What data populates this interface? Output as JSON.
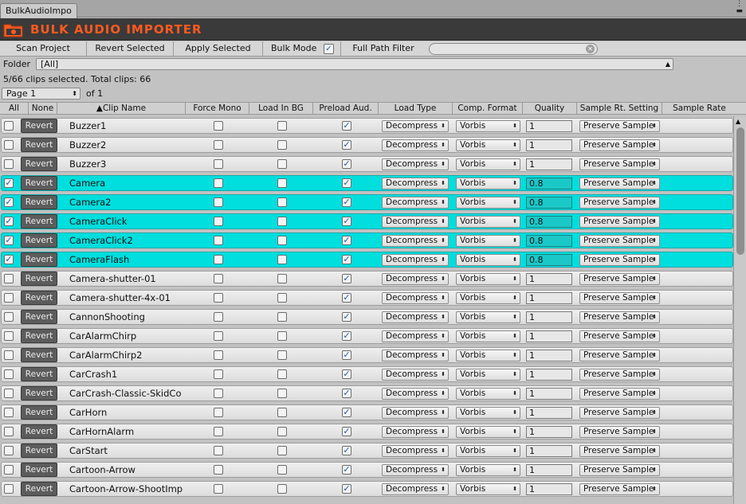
{
  "window": {
    "tab_title": "BulkAudioImpo",
    "menu_icon": "three-dots-icon",
    "close_icon": "close-icon"
  },
  "banner": {
    "title": "BULK AUDIO IMPORTER",
    "title_color": "#ff5a1f"
  },
  "toolbar": {
    "scan_label": "Scan Project",
    "revert_label": "Revert Selected",
    "apply_label": "Apply Selected",
    "bulk_mode_label": "Bulk Mode",
    "bulk_mode_checked": true,
    "filter_label": "Full Path Filter",
    "filter_value": ""
  },
  "folder": {
    "label": "Folder",
    "selected": "[All]"
  },
  "summary": "5/66 clips selected. Total clips: 66",
  "pager": {
    "selected": "Page 1",
    "of_label": "of 1"
  },
  "columns": {
    "all": "All",
    "none": "None",
    "clip_name": "▲Clip Name",
    "force_mono": "Force Mono",
    "load_in_bg": "Load In BG",
    "preload": "Preload Aud.",
    "load_type": "Load Type",
    "comp_format": "Comp. Format",
    "quality": "Quality",
    "sample_setting": "Sample Rt. Setting",
    "sample_rate": "Sample Rate"
  },
  "colors": {
    "selected_row": "#00dede",
    "revert_button": "#5c5c5c"
  },
  "rows": [
    {
      "selected": false,
      "revert": "Revert",
      "name": "Buzzer1",
      "force_mono": false,
      "load_bg": false,
      "preload": true,
      "load_type": "Decompress",
      "format": "Vorbis",
      "quality": "1",
      "sample_setting": "Preserve Sample"
    },
    {
      "selected": false,
      "revert": "Revert",
      "name": "Buzzer2",
      "force_mono": false,
      "load_bg": false,
      "preload": true,
      "load_type": "Decompress",
      "format": "Vorbis",
      "quality": "1",
      "sample_setting": "Preserve Sample"
    },
    {
      "selected": false,
      "revert": "Revert",
      "name": "Buzzer3",
      "force_mono": false,
      "load_bg": false,
      "preload": true,
      "load_type": "Decompress",
      "format": "Vorbis",
      "quality": "1",
      "sample_setting": "Preserve Sample"
    },
    {
      "selected": true,
      "revert": "Revert",
      "name": "Camera",
      "force_mono": false,
      "load_bg": false,
      "preload": true,
      "load_type": "Decompress",
      "format": "Vorbis",
      "quality": "0.8",
      "sample_setting": "Preserve Sample"
    },
    {
      "selected": true,
      "revert": "Revert",
      "name": "Camera2",
      "force_mono": false,
      "load_bg": false,
      "preload": true,
      "load_type": "Decompress",
      "format": "Vorbis",
      "quality": "0.8",
      "sample_setting": "Preserve Sample"
    },
    {
      "selected": true,
      "revert": "Revert",
      "name": "CameraClick",
      "force_mono": false,
      "load_bg": false,
      "preload": true,
      "load_type": "Decompress",
      "format": "Vorbis",
      "quality": "0.8",
      "sample_setting": "Preserve Sample"
    },
    {
      "selected": true,
      "revert": "Revert",
      "name": "CameraClick2",
      "force_mono": false,
      "load_bg": false,
      "preload": true,
      "load_type": "Decompress",
      "format": "Vorbis",
      "quality": "0.8",
      "sample_setting": "Preserve Sample"
    },
    {
      "selected": true,
      "revert": "Revert",
      "name": "CameraFlash",
      "force_mono": false,
      "load_bg": false,
      "preload": true,
      "load_type": "Decompress",
      "format": "Vorbis",
      "quality": "0.8",
      "sample_setting": "Preserve Sample"
    },
    {
      "selected": false,
      "revert": "Revert",
      "name": "Camera-shutter-01",
      "force_mono": false,
      "load_bg": false,
      "preload": true,
      "load_type": "Decompress",
      "format": "Vorbis",
      "quality": "1",
      "sample_setting": "Preserve Sample"
    },
    {
      "selected": false,
      "revert": "Revert",
      "name": "Camera-shutter-4x-01",
      "force_mono": false,
      "load_bg": false,
      "preload": true,
      "load_type": "Decompress",
      "format": "Vorbis",
      "quality": "1",
      "sample_setting": "Preserve Sample"
    },
    {
      "selected": false,
      "revert": "Revert",
      "name": "CannonShooting",
      "force_mono": false,
      "load_bg": false,
      "preload": true,
      "load_type": "Decompress",
      "format": "Vorbis",
      "quality": "1",
      "sample_setting": "Preserve Sample"
    },
    {
      "selected": false,
      "revert": "Revert",
      "name": "CarAlarmChirp",
      "force_mono": false,
      "load_bg": false,
      "preload": true,
      "load_type": "Decompress",
      "format": "Vorbis",
      "quality": "1",
      "sample_setting": "Preserve Sample"
    },
    {
      "selected": false,
      "revert": "Revert",
      "name": "CarAlarmChirp2",
      "force_mono": false,
      "load_bg": false,
      "preload": true,
      "load_type": "Decompress",
      "format": "Vorbis",
      "quality": "1",
      "sample_setting": "Preserve Sample"
    },
    {
      "selected": false,
      "revert": "Revert",
      "name": "CarCrash1",
      "force_mono": false,
      "load_bg": false,
      "preload": true,
      "load_type": "Decompress",
      "format": "Vorbis",
      "quality": "1",
      "sample_setting": "Preserve Sample"
    },
    {
      "selected": false,
      "revert": "Revert",
      "name": "CarCrash-Classic-SkidCo",
      "force_mono": false,
      "load_bg": false,
      "preload": true,
      "load_type": "Decompress",
      "format": "Vorbis",
      "quality": "1",
      "sample_setting": "Preserve Sample"
    },
    {
      "selected": false,
      "revert": "Revert",
      "name": "CarHorn",
      "force_mono": false,
      "load_bg": false,
      "preload": true,
      "load_type": "Decompress",
      "format": "Vorbis",
      "quality": "1",
      "sample_setting": "Preserve Sample"
    },
    {
      "selected": false,
      "revert": "Revert",
      "name": "CarHornAlarm",
      "force_mono": false,
      "load_bg": false,
      "preload": true,
      "load_type": "Decompress",
      "format": "Vorbis",
      "quality": "1",
      "sample_setting": "Preserve Sample"
    },
    {
      "selected": false,
      "revert": "Revert",
      "name": "CarStart",
      "force_mono": false,
      "load_bg": false,
      "preload": true,
      "load_type": "Decompress",
      "format": "Vorbis",
      "quality": "1",
      "sample_setting": "Preserve Sample"
    },
    {
      "selected": false,
      "revert": "Revert",
      "name": "Cartoon-Arrow",
      "force_mono": false,
      "load_bg": false,
      "preload": true,
      "load_type": "Decompress",
      "format": "Vorbis",
      "quality": "1",
      "sample_setting": "Preserve Sample"
    },
    {
      "selected": false,
      "revert": "Revert",
      "name": "Cartoon-Arrow-ShootImp",
      "force_mono": false,
      "load_bg": false,
      "preload": true,
      "load_type": "Decompress",
      "format": "Vorbis",
      "quality": "1",
      "sample_setting": "Preserve Sample"
    }
  ]
}
